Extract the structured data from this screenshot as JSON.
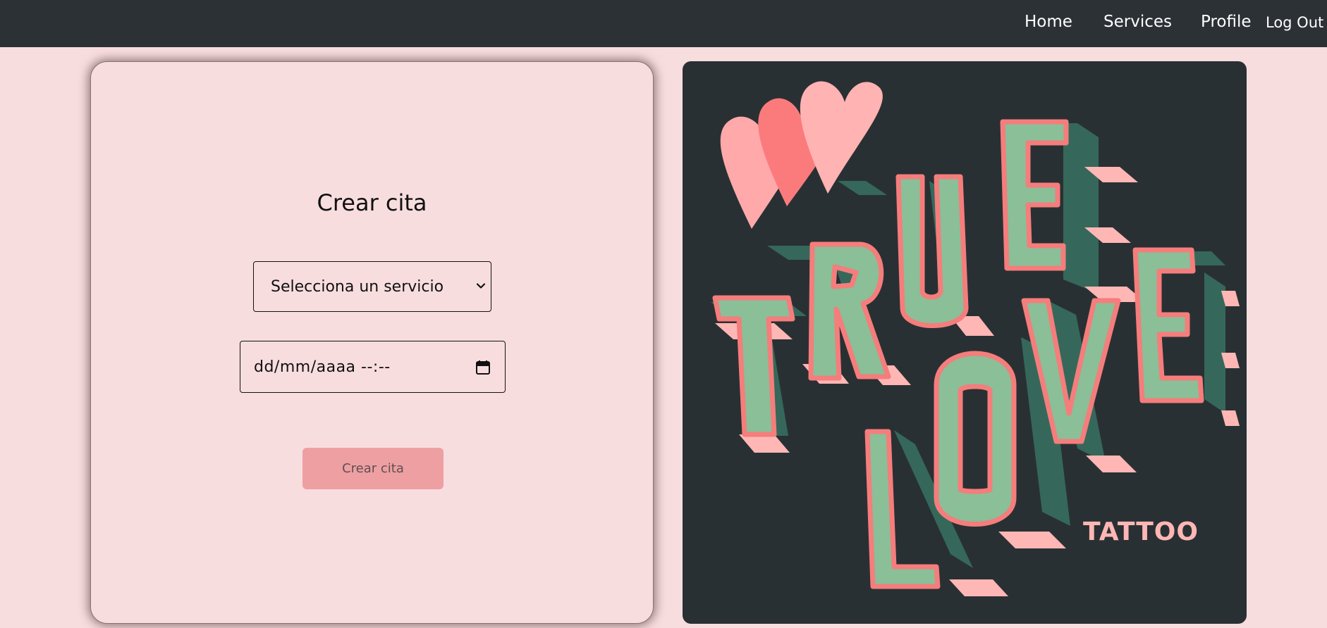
{
  "nav": {
    "home": "Home",
    "services": "Services",
    "profile": "Profile",
    "logout": "Log Out"
  },
  "form": {
    "title": "Crear cita",
    "service_select": {
      "selected": "Selecciona un servicio"
    },
    "datetime": {
      "value": "dd/mm/aaaa --:--"
    },
    "submit_label": "Crear cita"
  },
  "poster": {
    "logo_text": [
      "TRUE",
      "LOVE",
      "TATTOO"
    ]
  },
  "colors": {
    "navbar": "#2b3134",
    "page_bg": "#f8dddf",
    "button": "#ee9fa2",
    "poster_bg": "#293033",
    "letter_green": "#8abf98",
    "letter_outline": "#f57d7c",
    "letter_shadow_pink": "#ffb7b5",
    "letter_shadow_green": "#35685a"
  }
}
